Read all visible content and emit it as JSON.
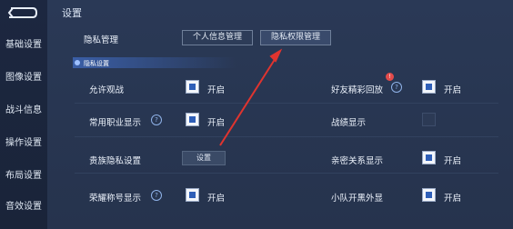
{
  "page": {
    "title": "设置"
  },
  "sidebar": {
    "items": [
      {
        "label": "基础设置"
      },
      {
        "label": "图像设置"
      },
      {
        "label": "战斗信息"
      },
      {
        "label": "操作设置"
      },
      {
        "label": "布局设置"
      },
      {
        "label": "音效设置"
      }
    ]
  },
  "privacy": {
    "label": "隐私管理",
    "tabs": [
      {
        "label": "个人信息管理"
      },
      {
        "label": "隐私权限管理"
      }
    ],
    "section_label": "隐私设置"
  },
  "settings": {
    "allow_watch": {
      "label": "允许观战",
      "state_label": "开启",
      "checked": true
    },
    "friend_highlight": {
      "label": "好友精彩回放",
      "state_label": "开启",
      "checked": true
    },
    "common_job": {
      "label": "常用职业显示",
      "state_label": "开启",
      "checked": true
    },
    "battle_status": {
      "label": "战绩显示",
      "checked": false
    },
    "noble_privacy": {
      "label": "贵族隐私设置",
      "button_label": "设置"
    },
    "intimate": {
      "label": "亲密关系显示",
      "state_label": "开启",
      "checked": true
    },
    "honor_title": {
      "label": "荣耀称号显示",
      "state_label": "开启",
      "checked": true
    },
    "team_open": {
      "label": "小队开黑外显",
      "state_label": "开启",
      "checked": true
    }
  },
  "colors": {
    "accent": "#2f5fb8",
    "background": "#23314a",
    "arrow": "#e0342f"
  }
}
